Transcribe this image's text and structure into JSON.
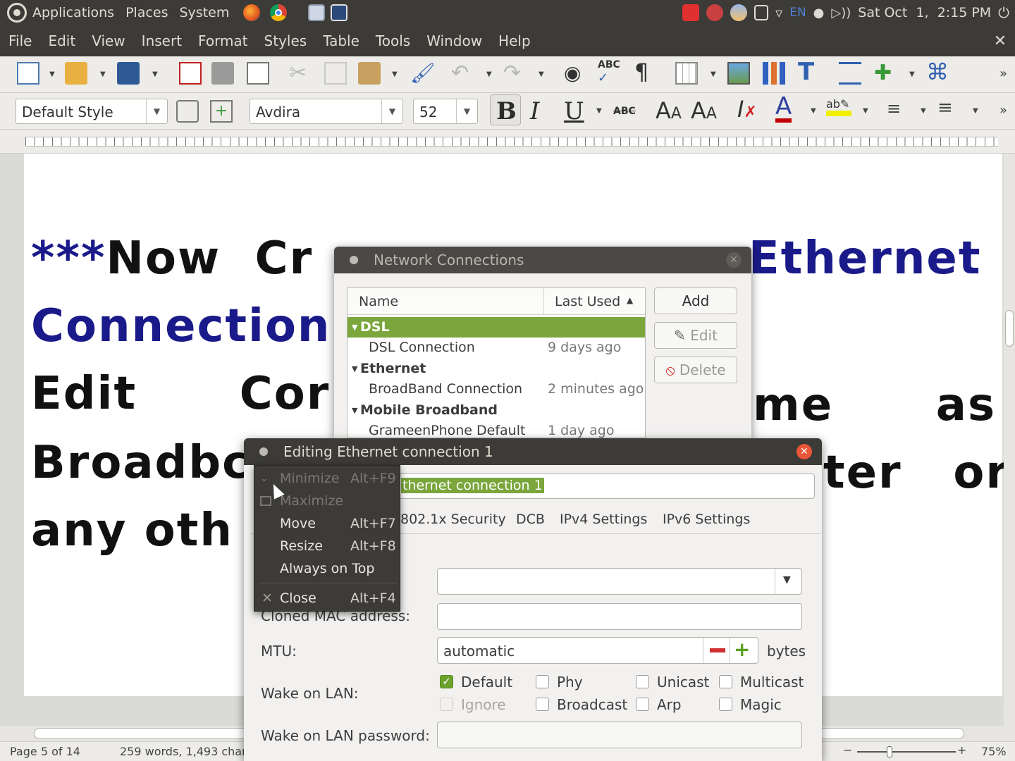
{
  "top_panel": {
    "menus": [
      "Applications",
      "Places",
      "System"
    ],
    "keyboard_layout": "EN",
    "clock": "Sat Oct  1,  2:15 PM"
  },
  "menubar": {
    "items": [
      "File",
      "Edit",
      "View",
      "Insert",
      "Format",
      "Styles",
      "Table",
      "Tools",
      "Window",
      "Help"
    ]
  },
  "format_toolbar": {
    "paragraph_style": "Default Style",
    "font_name": "Avdira",
    "font_size": "52",
    "strikethrough_label": "ABC"
  },
  "document": {
    "lines": [
      {
        "parts": [
          {
            "text": "***",
            "color": "#1a1a8a"
          },
          {
            "text": "Now  Cr",
            "color": "#111111"
          }
        ]
      },
      {
        "parts": [
          {
            "text": "Connection",
            "color": "#1a1a8a"
          }
        ]
      },
      {
        "parts": [
          {
            "text": "Edit      Cor",
            "color": "#111111"
          }
        ]
      },
      {
        "parts": [
          {
            "text": "Broadbc",
            "color": "#111111"
          }
        ]
      },
      {
        "parts": [
          {
            "text": "any oth",
            "color": "#111111"
          }
        ]
      }
    ],
    "right_fragments": [
      {
        "text": "Ethernet",
        "color": "#1a1a8a"
      },
      {
        "text": "me      as",
        "color": "#111111"
      },
      {
        "text": "ter   or",
        "color": "#111111"
      }
    ]
  },
  "network_connections": {
    "title": "Network Connections",
    "columns": [
      "Name",
      "Last Used"
    ],
    "groups": [
      {
        "name": "DSL",
        "items": [
          {
            "name": "DSL Connection",
            "last_used": "9 days ago"
          }
        ]
      },
      {
        "name": "Ethernet",
        "items": [
          {
            "name": "BroadBand Connection",
            "last_used": "2 minutes ago"
          }
        ]
      },
      {
        "name": "Mobile Broadband",
        "items": [
          {
            "name": "GrameenPhone Default",
            "last_used": "1 day ago"
          }
        ]
      }
    ],
    "buttons": {
      "add": "Add",
      "edit": "Edit",
      "delete": "Delete"
    }
  },
  "editing_dialog": {
    "title": "Editing Ethernet connection 1",
    "connection_name": "thernet connection 1",
    "tabs": [
      "802.1x Security",
      "DCB",
      "IPv4 Settings",
      "IPv6 Settings"
    ],
    "cloned_mac_label": "Cloned MAC address:",
    "mtu_label": "MTU:",
    "mtu_value": "automatic",
    "mtu_unit": "bytes",
    "wol_label": "Wake on LAN:",
    "wol_options": [
      {
        "label": "Default",
        "checked": true,
        "disabled": false
      },
      {
        "label": "Phy",
        "checked": false,
        "disabled": false
      },
      {
        "label": "Unicast",
        "checked": false,
        "disabled": false
      },
      {
        "label": "Multicast",
        "checked": false,
        "disabled": false
      },
      {
        "label": "Ignore",
        "checked": false,
        "disabled": true
      },
      {
        "label": "Broadcast",
        "checked": false,
        "disabled": false
      },
      {
        "label": "Arp",
        "checked": false,
        "disabled": false
      },
      {
        "label": "Magic",
        "checked": false,
        "disabled": false
      }
    ],
    "wol_password_label": "Wake on LAN password:"
  },
  "window_menu": {
    "items": [
      {
        "label": "Minimize",
        "shortcut": "Alt+F9",
        "disabled": true
      },
      {
        "label": "Maximize",
        "shortcut": "",
        "disabled": true
      },
      {
        "label": "Move",
        "shortcut": "Alt+F7",
        "disabled": false
      },
      {
        "label": "Resize",
        "shortcut": "Alt+F8",
        "disabled": false
      },
      {
        "label": "Always on Top",
        "shortcut": "",
        "disabled": false
      },
      {
        "label": "Close",
        "shortcut": "Alt+F4",
        "disabled": false
      }
    ]
  },
  "statusbar": {
    "page": "Page 5 of 14",
    "words": "259 words, 1,493 chara",
    "zoom": "75%"
  }
}
